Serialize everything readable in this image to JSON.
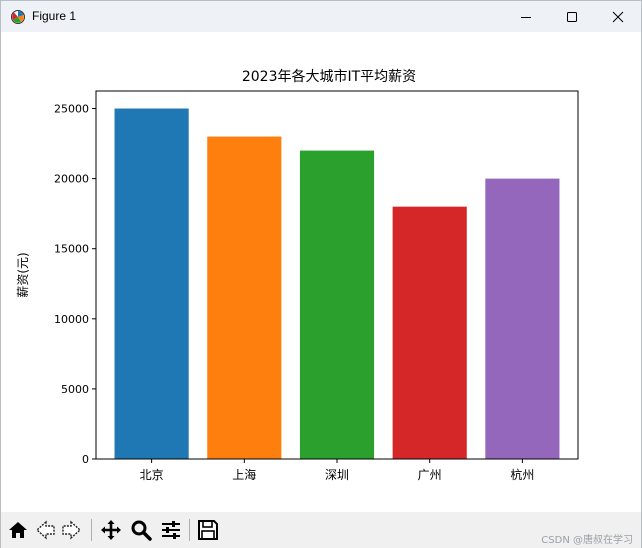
{
  "window": {
    "title": "Figure 1"
  },
  "toolbar": {
    "buttons": [
      "home-icon",
      "back-icon",
      "forward-icon",
      "pan-icon",
      "zoom-icon",
      "configure-subplots-icon",
      "save-icon"
    ],
    "watermark": "CSDN @唐叔在学习"
  },
  "chart_data": {
    "type": "bar",
    "title": "2023年各大城市IT平均薪资",
    "xlabel": "",
    "ylabel": "薪资(元)",
    "categories": [
      "北京",
      "上海",
      "深圳",
      "广州",
      "杭州"
    ],
    "values": [
      25000,
      23000,
      22000,
      18000,
      20000
    ],
    "colors": [
      "#1f77b4",
      "#ff7f0e",
      "#2ca02c",
      "#d62728",
      "#9467bd"
    ],
    "ylim": [
      0,
      26250
    ],
    "yticks": [
      0,
      5000,
      10000,
      15000,
      20000,
      25000
    ],
    "ytick_labels": [
      "0",
      "5000",
      "10000",
      "15000",
      "20000",
      "25000"
    ],
    "grid": false,
    "legend": "none"
  }
}
